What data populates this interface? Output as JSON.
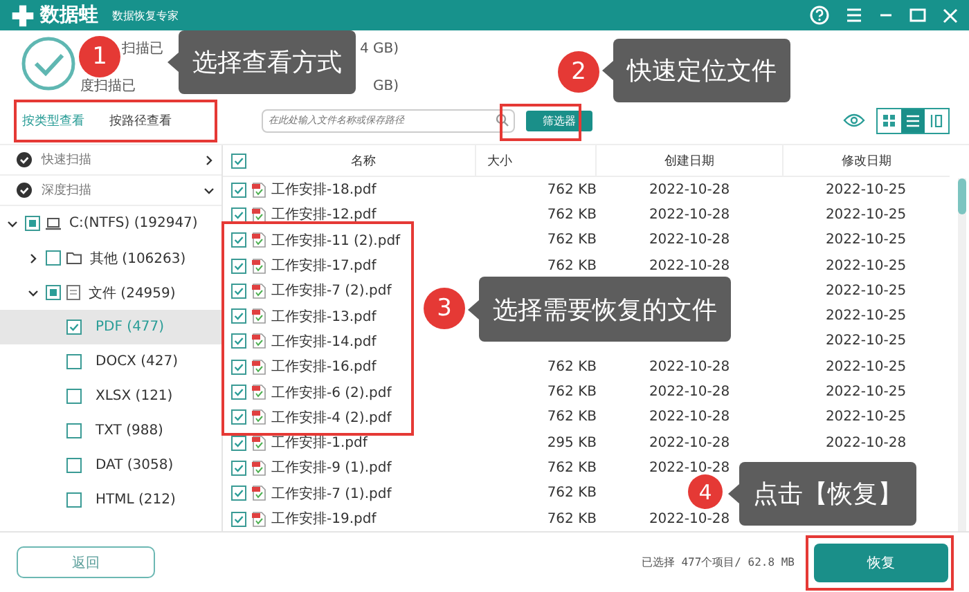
{
  "app": {
    "name": "数据蛙",
    "subtitle": "数据恢复专家"
  },
  "scan_summary": [
    {
      "before": "扫描已",
      "after": "4 GB)"
    },
    {
      "before": "度扫描已",
      "after": "GB)"
    }
  ],
  "view_tabs": [
    {
      "label": "按类型查看",
      "selected": true
    },
    {
      "label": "按路径查看",
      "selected": false
    }
  ],
  "search": {
    "placeholder": "在此处输入文件名称或保存路径"
  },
  "filter_button": "筛选器",
  "view_modes": [
    {
      "kind": "grid",
      "selected": false
    },
    {
      "kind": "list",
      "selected": true
    },
    {
      "kind": "columns",
      "selected": false
    }
  ],
  "scan_modes": [
    {
      "label": "快速扫描",
      "expanded": false
    },
    {
      "label": "深度扫描",
      "expanded": true
    }
  ],
  "tree": [
    {
      "label": "C:(NTFS) (192947)",
      "kind": "drive",
      "checked": true,
      "selected": false,
      "expanded": true,
      "children": [
        {
          "label": "其他 (106263)",
          "kind": "folder",
          "checked": false,
          "selected": false,
          "expanded": false
        },
        {
          "label": "文件 (24959)",
          "kind": "document",
          "checked": true,
          "selected": false,
          "expanded": true,
          "children": [
            {
              "label": "PDF (477)",
              "kind": "type",
              "checked": true,
              "selected": true
            },
            {
              "label": "DOCX (427)",
              "kind": "type",
              "checked": false,
              "selected": false
            },
            {
              "label": "XLSX (121)",
              "kind": "type",
              "checked": false,
              "selected": false
            },
            {
              "label": "TXT (988)",
              "kind": "type",
              "checked": false,
              "selected": false
            },
            {
              "label": "DAT (3058)",
              "kind": "type",
              "checked": false,
              "selected": false
            },
            {
              "label": "HTML (212)",
              "kind": "type",
              "checked": false,
              "selected": false
            }
          ]
        }
      ]
    }
  ],
  "table": {
    "header_checked": true,
    "columns": [
      "名称",
      "大小",
      "创建日期",
      "修改日期"
    ],
    "rows": [
      {
        "name": "工作安排-18.pdf",
        "size": "762 KB",
        "created": "2022-10-28",
        "modified": "2022-10-25",
        "checked": true
      },
      {
        "name": "工作安排-12.pdf",
        "size": "762 KB",
        "created": "2022-10-28",
        "modified": "2022-10-25",
        "checked": true
      },
      {
        "name": "工作安排-11 (2).pdf",
        "size": "762 KB",
        "created": "2022-10-28",
        "modified": "2022-10-25",
        "checked": true
      },
      {
        "name": "工作安排-17.pdf",
        "size": "762 KB",
        "created": "2022-10-28",
        "modified": "2022-10-25",
        "checked": true
      },
      {
        "name": "工作安排-7 (2).pdf",
        "modified": "2022-10-25",
        "checked": true
      },
      {
        "name": "工作安排-13.pdf",
        "modified": "2022-10-25",
        "checked": true
      },
      {
        "name": "工作安排-14.pdf",
        "modified": "2022-10-25",
        "checked": true
      },
      {
        "name": "工作安排-16.pdf",
        "size": "762 KB",
        "created": "2022-10-28",
        "modified": "2022-10-25",
        "checked": true
      },
      {
        "name": "工作安排-6 (2).pdf",
        "size": "762 KB",
        "created": "2022-10-28",
        "modified": "2022-10-25",
        "checked": true
      },
      {
        "name": "工作安排-4 (2).pdf",
        "size": "762 KB",
        "created": "2022-10-28",
        "modified": "2022-10-25",
        "checked": true
      },
      {
        "name": "工作安排-1.pdf",
        "size": "295 KB",
        "created": "2022-10-28",
        "modified": "2022-10-28",
        "checked": true
      },
      {
        "name": "工作安排-9 (1).pdf",
        "size": "762 KB",
        "created": "2022-10-28",
        "checked": true
      },
      {
        "name": "工作安排-7 (1).pdf",
        "size": "762 KB",
        "checked": true
      },
      {
        "name": "工作安排-19.pdf",
        "size": "762 KB",
        "created": "2022-10-28",
        "checked": true
      }
    ]
  },
  "back_button": "返回",
  "selection_status": "已选择 477个项目/ 62.8 MB",
  "recover_button": "恢复",
  "callouts": [
    {
      "number": "1",
      "text": "选择查看方式"
    },
    {
      "number": "2",
      "text": "快速定位文件"
    },
    {
      "number": "3",
      "text": "选择需要恢复的文件"
    },
    {
      "number": "4",
      "text": "点击【恢复】"
    }
  ]
}
